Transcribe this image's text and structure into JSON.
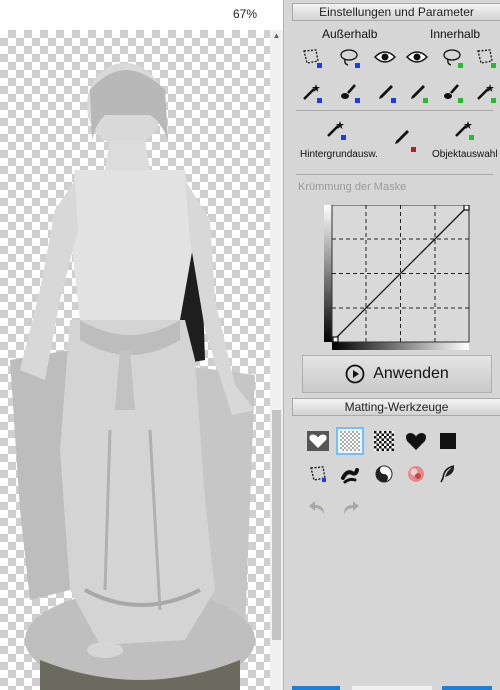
{
  "canvas": {
    "zoom_label": "67%"
  },
  "panel": {
    "settings_title": "Einstellungen und Parameter",
    "outside_label": "Außerhalb",
    "inside_label": "Innerhalb",
    "background_select_label": "Hintergrundausw.",
    "object_select_label": "Objektauswahl",
    "curve_title": "Krümmung der Maske",
    "apply_label": "Anwenden",
    "matting_title": "Matting-Werkzeuge"
  },
  "colors": {
    "outside_marker": "#1a3df0",
    "inside_marker": "#1fbf2a",
    "background_marker": "#c81818",
    "selected_tool_border": "#6ec0ff"
  },
  "icons": {
    "outside_row1": [
      "lasso-polygon-icon",
      "lasso-freehand-icon",
      "eye-icon"
    ],
    "inside_row1": [
      "eye-icon",
      "lasso-freehand-icon",
      "lasso-polygon-icon"
    ],
    "outside_row2": [
      "magic-wand-icon",
      "brush-icon",
      "pencil-icon"
    ],
    "inside_row2": [
      "pencil-icon",
      "brush-icon",
      "magic-wand-icon"
    ],
    "matting_row1": [
      "heart-outline-icon",
      "checker-light-icon",
      "checker-dark-icon",
      "heart-filled-icon",
      "square-filled-icon"
    ],
    "matting_row2": [
      "lasso-polygon-icon",
      "smudge-icon",
      "yin-yang-icon",
      "color-ball-icon",
      "feather-icon"
    ],
    "matting_row3": [
      "undo-icon",
      "redo-icon"
    ]
  }
}
